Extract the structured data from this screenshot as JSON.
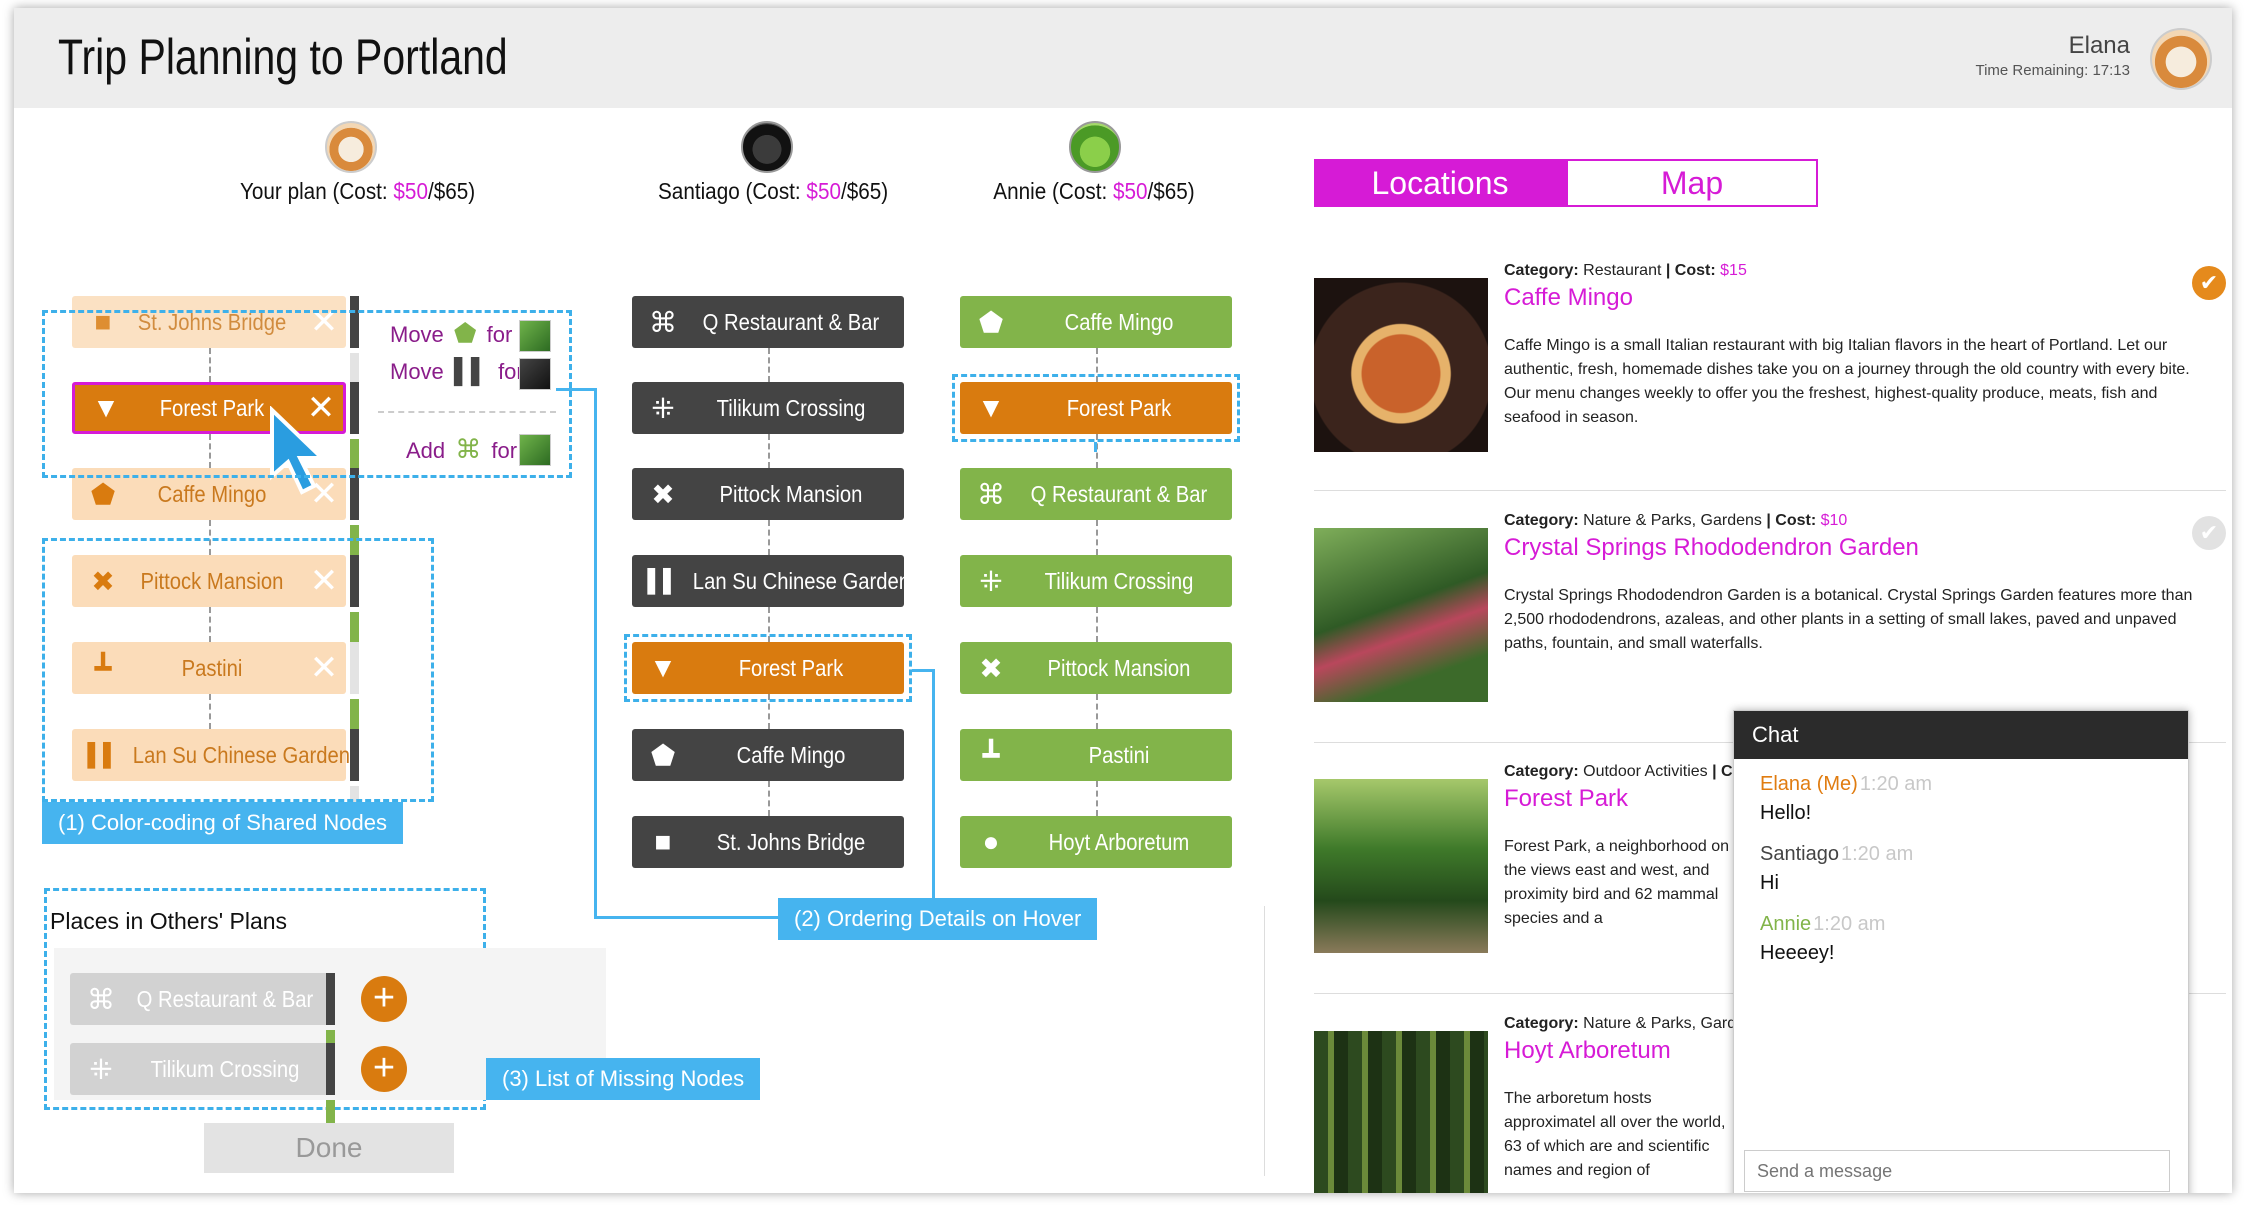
{
  "header": {
    "title": "Trip Planning to Portland",
    "user_name": "Elana",
    "time_remaining": "Time Remaining: 17:13"
  },
  "columns": [
    {
      "prefix": "Your plan (Cost: ",
      "cost": "$50",
      "suffix": "/$65)"
    },
    {
      "prefix": "Santiago (Cost: ",
      "cost": "$50",
      "suffix": "/$65)"
    },
    {
      "prefix": "Annie (Cost: ",
      "cost": "$50",
      "suffix": "/$65)"
    }
  ],
  "your_plan": [
    {
      "label": "St. Johns Bridge",
      "icon": "square-icon",
      "glyph": "■"
    },
    {
      "label": "Forest Park",
      "icon": "triangle-down-icon",
      "glyph": "▼"
    },
    {
      "label": "Caffe Mingo",
      "icon": "pentagon-icon",
      "glyph": "⬟"
    },
    {
      "label": "Pittock Mansion",
      "icon": "cross-icon",
      "glyph": "✖"
    },
    {
      "label": "Pastini",
      "icon": "stand-icon",
      "glyph": "┻"
    },
    {
      "label": "Lan Su Chinese Garden",
      "icon": "double-bar-icon",
      "glyph": "▌▌"
    }
  ],
  "santiago_plan": [
    {
      "label": "Q Restaurant & Bar",
      "icon": "cog-square-icon",
      "glyph": "⌘"
    },
    {
      "label": "Tilikum Crossing",
      "icon": "four-dots-icon",
      "glyph": "⁜"
    },
    {
      "label": "Pittock Mansion",
      "icon": "cross-icon",
      "glyph": "✖"
    },
    {
      "label": "Lan Su Chinese Garden",
      "icon": "double-bar-icon",
      "glyph": "▌▌"
    },
    {
      "label": "Forest Park",
      "icon": "triangle-down-icon",
      "glyph": "▼"
    },
    {
      "label": "Caffe Mingo",
      "icon": "pentagon-icon",
      "glyph": "⬟"
    },
    {
      "label": "St. Johns Bridge",
      "icon": "square-icon",
      "glyph": "■"
    }
  ],
  "annie_plan": [
    {
      "label": "Caffe Mingo",
      "icon": "pentagon-icon",
      "glyph": "⬟"
    },
    {
      "label": "Forest Park",
      "icon": "triangle-down-icon",
      "glyph": "▼"
    },
    {
      "label": "Q Restaurant & Bar",
      "icon": "cog-square-icon",
      "glyph": "⌘"
    },
    {
      "label": "Tilikum Crossing",
      "icon": "four-dots-icon",
      "glyph": "⁜"
    },
    {
      "label": "Pittock Mansion",
      "icon": "cross-icon",
      "glyph": "✖"
    },
    {
      "label": "Pastini",
      "icon": "stand-icon",
      "glyph": "┻"
    },
    {
      "label": "Hoyt Arboretum",
      "icon": "circle-icon",
      "glyph": "●"
    }
  ],
  "hints": [
    {
      "verb": "Move",
      "word": "for"
    },
    {
      "verb": "Move",
      "word": "for"
    },
    {
      "verb": "Add",
      "word": "for"
    }
  ],
  "labels": {
    "color_coding": "(1) Color-coding of Shared Nodes",
    "ordering": "(2) Ordering Details on Hover",
    "missing": "(3) List of Missing Nodes"
  },
  "missing": {
    "title": "Places in Others' Plans",
    "items": [
      {
        "label": "Q Restaurant & Bar",
        "glyph": "⌘"
      },
      {
        "label": "Tilikum Crossing",
        "glyph": "⁜"
      }
    ],
    "add_glyph": "+"
  },
  "done_label": "Done",
  "tabs": {
    "locations": "Locations",
    "map": "Map"
  },
  "locations": [
    {
      "category_label": "Category:",
      "category": "Restaurant",
      "sep": "|",
      "cost_label": "Cost:",
      "cost": "$15",
      "name": "Caffe Mingo",
      "description": "Caffe Mingo is a small Italian restaurant with big Italian flavors in the heart of Portland. Let our authentic, fresh, homemade dishes take you on a journey through the old country with every bite. Our menu changes weekly to offer you the freshest, highest-quality produce, meats, fish and seafood in season.",
      "check": "✔"
    },
    {
      "category_label": "Category:",
      "category": "Nature & Parks, Gardens",
      "sep": "|",
      "cost_label": "Cost:",
      "cost": "$10",
      "name": "Crystal Springs Rhododendron Garden",
      "description": "Crystal Springs Rhododendron Garden is a botanical. Crystal Springs Garden features more than 2,500 rhododendrons, azaleas, and other plants in a setting of small lakes, paved and unpaved paths, fountain, and small waterfalls.",
      "check": "✔"
    },
    {
      "category_label": "Category:",
      "category": "Outdoor Activities",
      "sep": "|",
      "cost_label": "Cost",
      "cost": "",
      "name": "Forest Park",
      "description": "Forest Park, a neighborhood on the views east and west, and proximity bird and 62 mammal species and a",
      "check": ""
    },
    {
      "category_label": "Category:",
      "category": "Nature & Parks, Gardens",
      "sep": "",
      "cost_label": "",
      "cost": "",
      "name": "Hoyt Arboretum",
      "description": "The arboretum hosts approximatel all over the world, 63 of which are and scientific names and region of",
      "check": ""
    }
  ],
  "chat": {
    "title": "Chat",
    "messages": [
      {
        "who": "Elana (Me)",
        "time": "1:20 am",
        "text": "Hello!"
      },
      {
        "who": "Santiago",
        "time": "1:20 am",
        "text": "Hi"
      },
      {
        "who": "Annie",
        "time": "1:20 am",
        "text": "Heeeey!"
      }
    ],
    "placeholder": "Send a message"
  },
  "colors": {
    "accent_magenta": "#d61bd6",
    "orange": "#d97b0f",
    "green": "#82b44a",
    "dark": "#444444",
    "blue": "#46b4ef"
  }
}
